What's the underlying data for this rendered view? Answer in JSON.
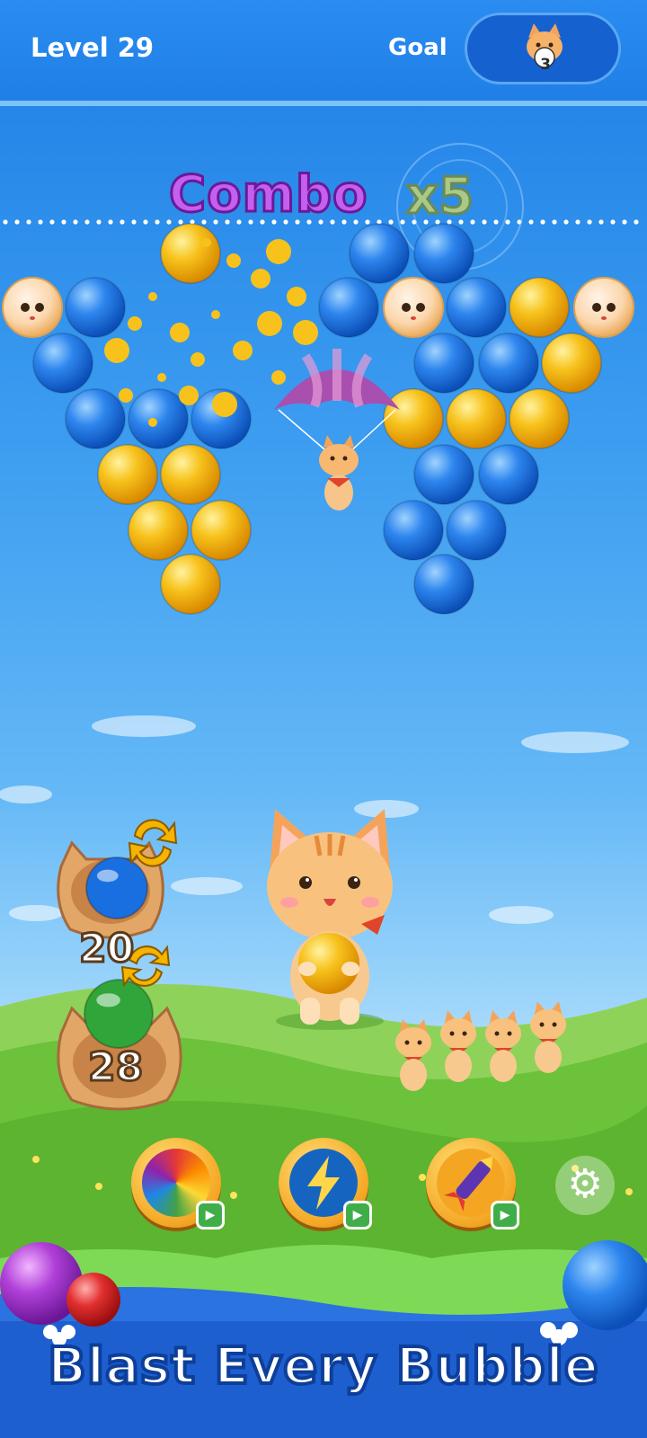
{
  "hud": {
    "level_label": "Level 29",
    "goal_label": "Goal",
    "goal_count": "3",
    "goal_icon": "cat-face-icon"
  },
  "combo": {
    "word": "Combo",
    "multiplier": "x5"
  },
  "shooter": {
    "current_ball_color": "#f4b400",
    "queue": [
      {
        "color": "#1a6fe0",
        "count": "20"
      },
      {
        "color": "#2fa53a",
        "count": "28"
      }
    ],
    "swap_icon": "swap-arrows-icon"
  },
  "boosters": [
    {
      "name": "rainbow-ball-booster",
      "icon": "rainbow-ball-icon",
      "video_icon": "video-ad-icon"
    },
    {
      "name": "lightning-booster",
      "icon": "lightning-icon",
      "video_icon": "video-ad-icon"
    },
    {
      "name": "rocket-booster",
      "icon": "rocket-icon",
      "video_icon": "video-ad-icon"
    }
  ],
  "settings_icon": "gear-icon",
  "slogan": "Blast Every Bubble",
  "colors": {
    "blue_bubble": "#1a6fe0",
    "yellow_bubble": "#f4b400",
    "green_bubble": "#2fa53a",
    "sky_top": "#1f7fe6",
    "grass": "#6cc23a"
  }
}
